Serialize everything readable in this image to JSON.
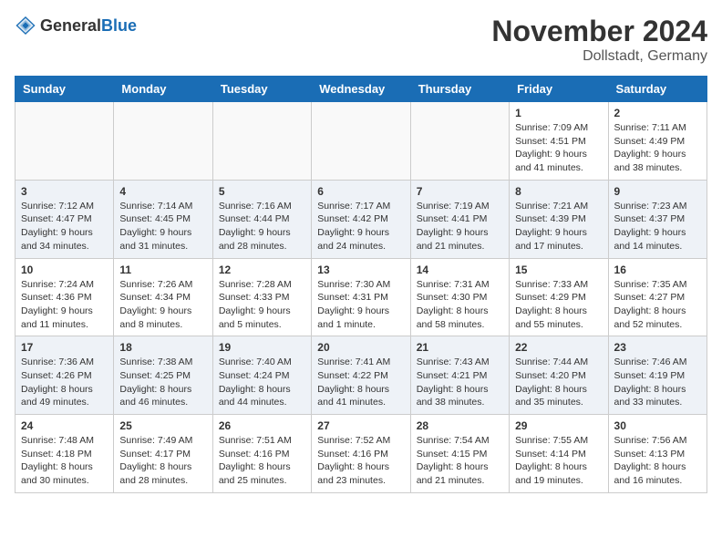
{
  "header": {
    "logo_general": "General",
    "logo_blue": "Blue",
    "month_title": "November 2024",
    "location": "Dollstadt, Germany"
  },
  "weekdays": [
    "Sunday",
    "Monday",
    "Tuesday",
    "Wednesday",
    "Thursday",
    "Friday",
    "Saturday"
  ],
  "weeks": [
    [
      {
        "day": "",
        "info": ""
      },
      {
        "day": "",
        "info": ""
      },
      {
        "day": "",
        "info": ""
      },
      {
        "day": "",
        "info": ""
      },
      {
        "day": "",
        "info": ""
      },
      {
        "day": "1",
        "info": "Sunrise: 7:09 AM\nSunset: 4:51 PM\nDaylight: 9 hours\nand 41 minutes."
      },
      {
        "day": "2",
        "info": "Sunrise: 7:11 AM\nSunset: 4:49 PM\nDaylight: 9 hours\nand 38 minutes."
      }
    ],
    [
      {
        "day": "3",
        "info": "Sunrise: 7:12 AM\nSunset: 4:47 PM\nDaylight: 9 hours\nand 34 minutes."
      },
      {
        "day": "4",
        "info": "Sunrise: 7:14 AM\nSunset: 4:45 PM\nDaylight: 9 hours\nand 31 minutes."
      },
      {
        "day": "5",
        "info": "Sunrise: 7:16 AM\nSunset: 4:44 PM\nDaylight: 9 hours\nand 28 minutes."
      },
      {
        "day": "6",
        "info": "Sunrise: 7:17 AM\nSunset: 4:42 PM\nDaylight: 9 hours\nand 24 minutes."
      },
      {
        "day": "7",
        "info": "Sunrise: 7:19 AM\nSunset: 4:41 PM\nDaylight: 9 hours\nand 21 minutes."
      },
      {
        "day": "8",
        "info": "Sunrise: 7:21 AM\nSunset: 4:39 PM\nDaylight: 9 hours\nand 17 minutes."
      },
      {
        "day": "9",
        "info": "Sunrise: 7:23 AM\nSunset: 4:37 PM\nDaylight: 9 hours\nand 14 minutes."
      }
    ],
    [
      {
        "day": "10",
        "info": "Sunrise: 7:24 AM\nSunset: 4:36 PM\nDaylight: 9 hours\nand 11 minutes."
      },
      {
        "day": "11",
        "info": "Sunrise: 7:26 AM\nSunset: 4:34 PM\nDaylight: 9 hours\nand 8 minutes."
      },
      {
        "day": "12",
        "info": "Sunrise: 7:28 AM\nSunset: 4:33 PM\nDaylight: 9 hours\nand 5 minutes."
      },
      {
        "day": "13",
        "info": "Sunrise: 7:30 AM\nSunset: 4:31 PM\nDaylight: 9 hours\nand 1 minute."
      },
      {
        "day": "14",
        "info": "Sunrise: 7:31 AM\nSunset: 4:30 PM\nDaylight: 8 hours\nand 58 minutes."
      },
      {
        "day": "15",
        "info": "Sunrise: 7:33 AM\nSunset: 4:29 PM\nDaylight: 8 hours\nand 55 minutes."
      },
      {
        "day": "16",
        "info": "Sunrise: 7:35 AM\nSunset: 4:27 PM\nDaylight: 8 hours\nand 52 minutes."
      }
    ],
    [
      {
        "day": "17",
        "info": "Sunrise: 7:36 AM\nSunset: 4:26 PM\nDaylight: 8 hours\nand 49 minutes."
      },
      {
        "day": "18",
        "info": "Sunrise: 7:38 AM\nSunset: 4:25 PM\nDaylight: 8 hours\nand 46 minutes."
      },
      {
        "day": "19",
        "info": "Sunrise: 7:40 AM\nSunset: 4:24 PM\nDaylight: 8 hours\nand 44 minutes."
      },
      {
        "day": "20",
        "info": "Sunrise: 7:41 AM\nSunset: 4:22 PM\nDaylight: 8 hours\nand 41 minutes."
      },
      {
        "day": "21",
        "info": "Sunrise: 7:43 AM\nSunset: 4:21 PM\nDaylight: 8 hours\nand 38 minutes."
      },
      {
        "day": "22",
        "info": "Sunrise: 7:44 AM\nSunset: 4:20 PM\nDaylight: 8 hours\nand 35 minutes."
      },
      {
        "day": "23",
        "info": "Sunrise: 7:46 AM\nSunset: 4:19 PM\nDaylight: 8 hours\nand 33 minutes."
      }
    ],
    [
      {
        "day": "24",
        "info": "Sunrise: 7:48 AM\nSunset: 4:18 PM\nDaylight: 8 hours\nand 30 minutes."
      },
      {
        "day": "25",
        "info": "Sunrise: 7:49 AM\nSunset: 4:17 PM\nDaylight: 8 hours\nand 28 minutes."
      },
      {
        "day": "26",
        "info": "Sunrise: 7:51 AM\nSunset: 4:16 PM\nDaylight: 8 hours\nand 25 minutes."
      },
      {
        "day": "27",
        "info": "Sunrise: 7:52 AM\nSunset: 4:16 PM\nDaylight: 8 hours\nand 23 minutes."
      },
      {
        "day": "28",
        "info": "Sunrise: 7:54 AM\nSunset: 4:15 PM\nDaylight: 8 hours\nand 21 minutes."
      },
      {
        "day": "29",
        "info": "Sunrise: 7:55 AM\nSunset: 4:14 PM\nDaylight: 8 hours\nand 19 minutes."
      },
      {
        "day": "30",
        "info": "Sunrise: 7:56 AM\nSunset: 4:13 PM\nDaylight: 8 hours\nand 16 minutes."
      }
    ]
  ]
}
